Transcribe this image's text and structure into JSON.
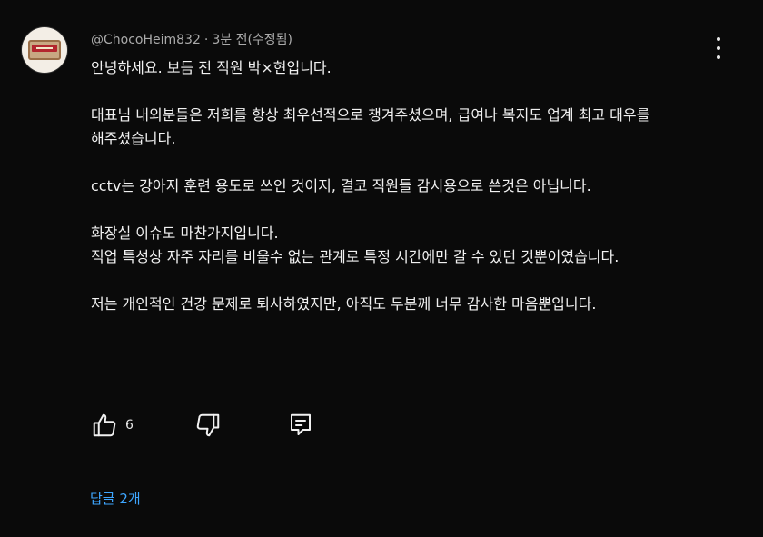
{
  "comment": {
    "author": "@ChocoHeim832",
    "separator": "·",
    "time": "3분 전(수정됨)",
    "paragraphs": [
      "안녕하세요. 보듬 전 직원 박×현입니다.",
      "대표님 내외분들은 저희를 항상 최우선적으로 챙겨주셨으며, 급여나 복지도 업계 최고 대우를\n해주셨습니다.",
      "cctv는 강아지 훈련 용도로 쓰인 것이지, 결코 직원들 감시용으로 쓴것은 아닙니다.",
      "화장실 이슈도 마찬가지입니다.\n직업 특성상 자주 자리를 비울수 없는 관계로 특정 시간에만 갈 수 있던 것뿐이였습니다.",
      "저는 개인적인 건강 문제로 퇴사하였지만, 아직도 두분께 너무 감사한 마음뿐입니다."
    ],
    "like_count": "6",
    "replies_label": "답글 2개"
  },
  "icons": {
    "avatar": "avatar-image",
    "more": "more-vert-icon",
    "like": "thumbs-up-icon",
    "dislike": "thumbs-down-icon",
    "reply": "reply-comment-icon"
  },
  "colors": {
    "background": "#0a0a0a",
    "text": "#f1f1f1",
    "meta": "#aaaaaa",
    "link": "#3ea6ff"
  }
}
